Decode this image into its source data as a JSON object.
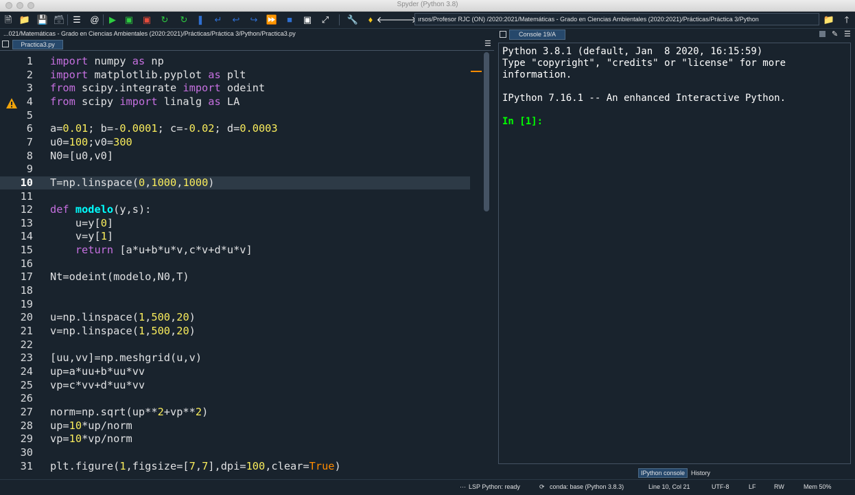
{
  "window": {
    "title": "Spyder (Python 3.8)"
  },
  "toolbar": {
    "icons": [
      "new-file-icon",
      "open-folder-icon",
      "save-icon",
      "save-all-icon",
      "outline-icon",
      "at-icon",
      "run-icon",
      "run-cell-icon",
      "run-cell-advance-icon",
      "rerun-icon",
      "debug-icon",
      "step-icon",
      "step-in-icon",
      "continue-icon",
      "stop-icon",
      "maximize-icon",
      "fullscreen-icon",
      "preferences-icon",
      "python-path-icon",
      "back-icon",
      "forward-icon",
      "browse-icon",
      "up-icon"
    ],
    "path": "ırsos/Profesor RJC (ON) /2020:2021/Matemáticas - Grado en Ciencias Ambientales (2020:2021)/Prácticas/Práctica 3/Python"
  },
  "editor": {
    "filepath": "...021/Matemáticas - Grado en Ciencias Ambientales (2020:2021)/Prácticas/Práctica 3/Python/Practica3.py",
    "tab": "Practica3.py",
    "current_line": 10,
    "lines": [
      {
        "n": "1",
        "code": "import numpy as np"
      },
      {
        "n": "2",
        "code": "import matplotlib.pyplot as plt"
      },
      {
        "n": "3",
        "code": "from scipy.integrate import odeint"
      },
      {
        "n": "4",
        "code": "from scipy import linalg as LA"
      },
      {
        "n": "5",
        "code": ""
      },
      {
        "n": "6",
        "code": "a=0.01; b=-0.0001; c=-0.02; d=0.0003"
      },
      {
        "n": "7",
        "code": "u0=100;v0=300"
      },
      {
        "n": "8",
        "code": "N0=[u0,v0]"
      },
      {
        "n": "9",
        "code": ""
      },
      {
        "n": "10",
        "code": "T=np.linspace(0,1000,1000)"
      },
      {
        "n": "11",
        "code": ""
      },
      {
        "n": "12",
        "code": "def modelo(y,s):"
      },
      {
        "n": "13",
        "code": "    u=y[0]"
      },
      {
        "n": "14",
        "code": "    v=y[1]"
      },
      {
        "n": "15",
        "code": "    return [a*u+b*u*v,c*v+d*u*v]"
      },
      {
        "n": "16",
        "code": ""
      },
      {
        "n": "17",
        "code": "Nt=odeint(modelo,N0,T)"
      },
      {
        "n": "18",
        "code": ""
      },
      {
        "n": "19",
        "code": ""
      },
      {
        "n": "20",
        "code": "u=np.linspace(1,500,20)"
      },
      {
        "n": "21",
        "code": "v=np.linspace(1,500,20)"
      },
      {
        "n": "22",
        "code": ""
      },
      {
        "n": "23",
        "code": "[uu,vv]=np.meshgrid(u,v)"
      },
      {
        "n": "24",
        "code": "up=a*uu+b*uu*vv"
      },
      {
        "n": "25",
        "code": "vp=c*vv+d*uu*vv"
      },
      {
        "n": "26",
        "code": ""
      },
      {
        "n": "27",
        "code": "norm=np.sqrt(up**2+vp**2)"
      },
      {
        "n": "28",
        "code": "up=10*up/norm"
      },
      {
        "n": "29",
        "code": "vp=10*vp/norm"
      },
      {
        "n": "30",
        "code": ""
      },
      {
        "n": "31",
        "code": "plt.figure(1,figsize=[7,7],dpi=100,clear=True)"
      }
    ]
  },
  "console": {
    "tab": "Console 19/A",
    "lines": [
      "Python 3.8.1 (default, Jan  8 2020, 16:15:59)",
      "Type \"copyright\", \"credits\" or \"license\" for more",
      "information.",
      "",
      "IPython 7.16.1 -- An enhanced Interactive Python.",
      ""
    ],
    "prompt": "In [1]:"
  },
  "bottom_tabs": [
    "IPython console",
    "History"
  ],
  "status": {
    "lsp": "LSP Python: ready",
    "conda": "conda: base (Python 3.8.3)",
    "position": "Line 10, Col 21",
    "encoding": "UTF-8",
    "eol": "LF",
    "mode": "RW",
    "mem": "Mem 50%"
  },
  "colors": {
    "background": "#19232d",
    "keyword": "#c670e0",
    "number": "#faed5c",
    "function": "#00ffff",
    "prompt": "#00ff00"
  }
}
